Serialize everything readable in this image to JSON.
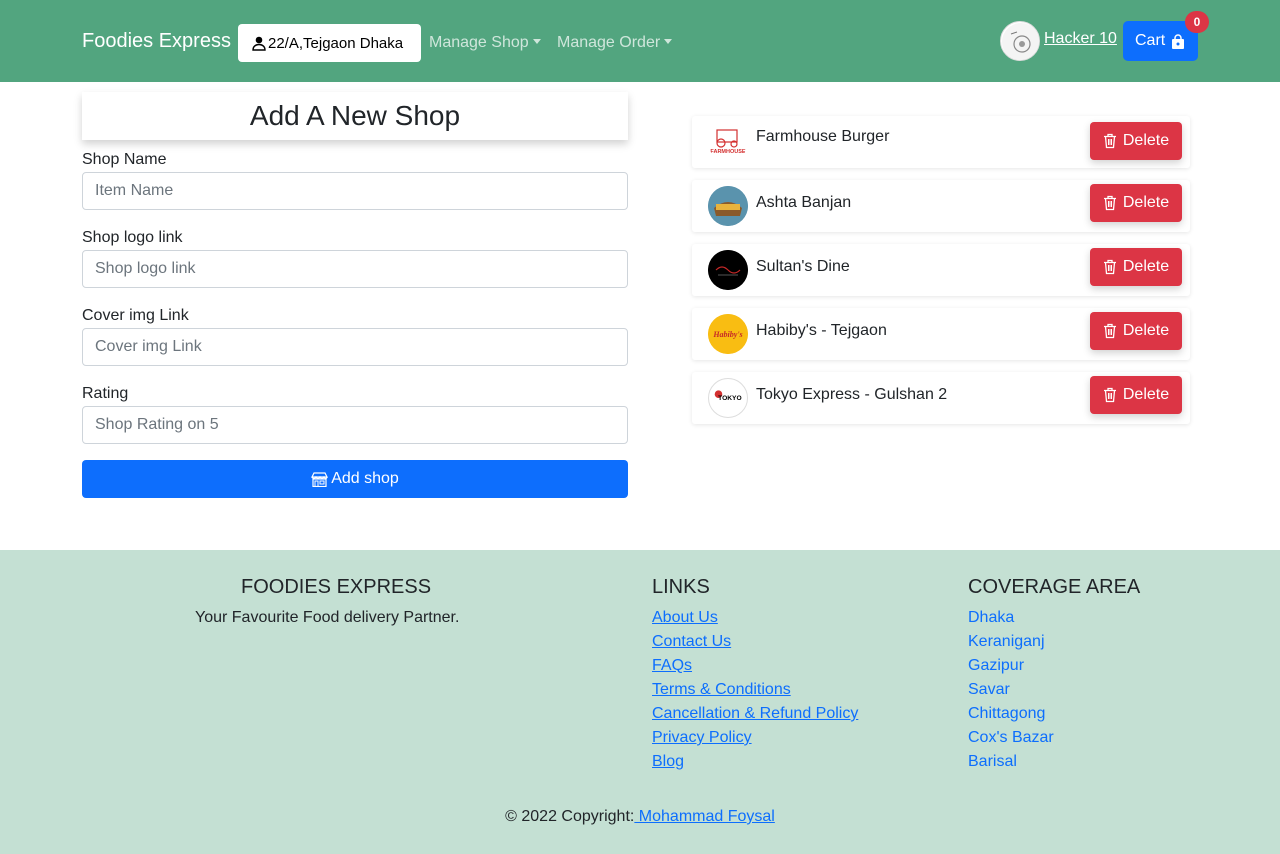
{
  "nav": {
    "brand": "Foodies Express",
    "address": "22/A,Tejgaon Dhaka",
    "manage_shop": "Manage Shop",
    "manage_order": "Manage Order",
    "user_name": "Hacker 10",
    "cart_label": "Cart",
    "cart_count": "0"
  },
  "form": {
    "title": "Add A New Shop",
    "fields": [
      {
        "label": "Shop Name",
        "placeholder": "Item Name"
      },
      {
        "label": "Shop logo link",
        "placeholder": "Shop logo link"
      },
      {
        "label": "Cover img Link",
        "placeholder": "Cover img Link"
      },
      {
        "label": "Rating",
        "placeholder": "Shop Rating on 5"
      }
    ],
    "submit_label": "Add shop"
  },
  "shops": [
    {
      "name": "Farmhouse Burger",
      "logo_text": "FARMHOUSE",
      "delete_label": "Delete"
    },
    {
      "name": "Ashta Banjan",
      "logo_text": "",
      "delete_label": "Delete"
    },
    {
      "name": "Sultan's Dine",
      "logo_text": "",
      "delete_label": "Delete"
    },
    {
      "name": "Habiby's - Tejgaon",
      "logo_text": "Habiby's",
      "delete_label": "Delete"
    },
    {
      "name": "Tokyo Express - Gulshan 2",
      "logo_text": "TOKYO",
      "delete_label": "Delete"
    }
  ],
  "footer": {
    "brand_title": "FOODIES EXPRESS",
    "tagline": "Your Favourite Food delivery Partner.",
    "links_title": "LINKS",
    "links": [
      "About Us",
      "Contact Us",
      "FAQs",
      "Terms & Conditions",
      "Cancellation & Refund Policy",
      "Privacy Policy",
      "Blog"
    ],
    "coverage_title": "COVERAGE AREA",
    "coverage": [
      "Dhaka",
      "Keraniganj",
      "Gazipur",
      "Savar",
      "Chittagong",
      "Cox's Bazar",
      "Barisal"
    ],
    "copyright_prefix": "© 2022 Copyright:",
    "copyright_author": " Mohammad Foysal"
  },
  "colors": {
    "navbar": "#52a57f",
    "primary": "#0d6efd",
    "danger": "#dc3545",
    "footer": "#c4e0d3"
  }
}
